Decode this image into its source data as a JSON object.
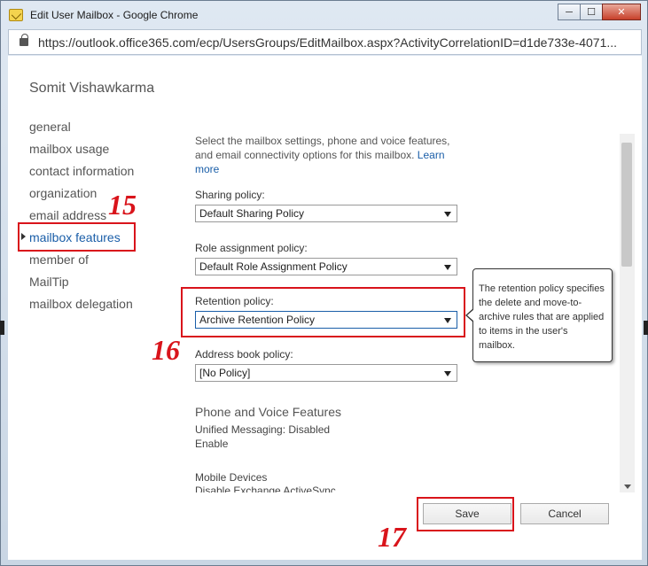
{
  "window": {
    "title": "Edit User Mailbox - Google Chrome"
  },
  "controls": {
    "minimize": "─",
    "maximize": "☐",
    "close": "✕"
  },
  "address": {
    "url": "https://outlook.office365.com/ecp/UsersGroups/EditMailbox.aspx?ActivityCorrelationID=d1de733e-4071..."
  },
  "user": {
    "name": "Somit Vishawkarma"
  },
  "nav": {
    "items": [
      {
        "label": "general"
      },
      {
        "label": "mailbox usage"
      },
      {
        "label": "contact information"
      },
      {
        "label": "organization"
      },
      {
        "label": "email address"
      },
      {
        "label": "mailbox features"
      },
      {
        "label": "member of"
      },
      {
        "label": "MailTip"
      },
      {
        "label": "mailbox delegation"
      }
    ],
    "active_index": 5
  },
  "main": {
    "intro": "Select the mailbox settings, phone and voice features, and email connectivity options for this mailbox.",
    "learn_more": "Learn more",
    "sharing_label": "Sharing policy:",
    "sharing_value": "Default Sharing Policy",
    "role_label": "Role assignment policy:",
    "role_value": "Default Role Assignment Policy",
    "retention_label": "Retention policy:",
    "retention_value": "Archive Retention Policy",
    "address_book_label": "Address book policy:",
    "address_book_value": "[No Policy]",
    "phone_voice_title": "Phone and Voice Features",
    "um_status": "Unified Messaging: Disabled",
    "um_enable": "Enable",
    "mobile_title": "Mobile Devices",
    "mobile_link": "Disable Exchange ActiveSync"
  },
  "callout": {
    "text": "The retention policy specifies the delete and move-to-archive rules that are applied to items in the user's mailbox."
  },
  "buttons": {
    "save": "Save",
    "cancel": "Cancel"
  },
  "annotations": {
    "step15": "15",
    "step16": "16",
    "step17": "17"
  },
  "colors": {
    "accent": "#1a5ea8",
    "annotation": "#d9141b"
  }
}
